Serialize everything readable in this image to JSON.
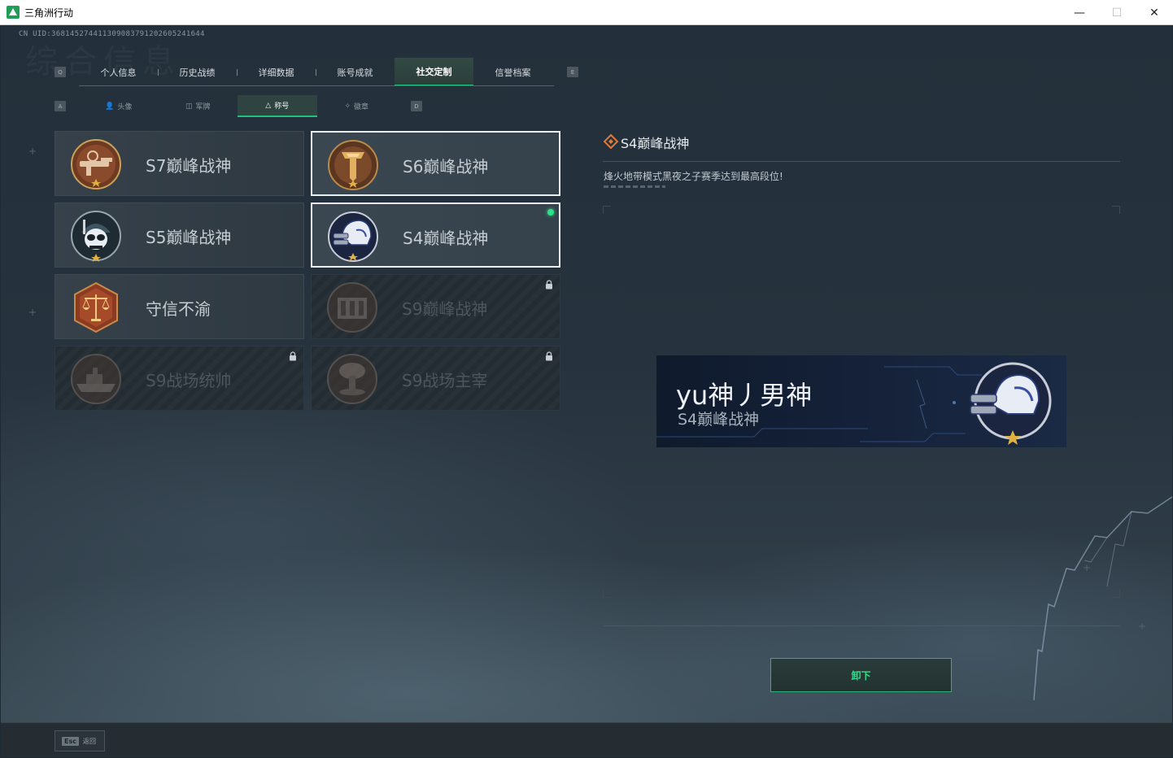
{
  "window": {
    "title": "三角洲行动",
    "controls": [
      "—",
      "☐",
      "✕"
    ]
  },
  "uid": "CN UID:368145274411309083791202605241644",
  "ghost_title": "综合信息",
  "tabs": {
    "prev_key": "Q",
    "next_key": "E",
    "items": [
      {
        "label": "个人信息",
        "active": false
      },
      {
        "label": "历史战绩",
        "active": false
      },
      {
        "label": "详细数据",
        "active": false
      },
      {
        "label": "账号成就",
        "active": false
      },
      {
        "label": "社交定制",
        "active": true
      },
      {
        "label": "信誉档案",
        "active": false
      }
    ]
  },
  "subtabs": {
    "prev_key": "A",
    "next_key": "D",
    "items": [
      {
        "label": "头像",
        "glyph": "👤",
        "active": false
      },
      {
        "label": "军牌",
        "glyph": "◫",
        "active": false
      },
      {
        "label": "称号",
        "glyph": "△",
        "active": true
      },
      {
        "label": "徽章",
        "glyph": "✧",
        "active": false
      }
    ]
  },
  "titles": [
    {
      "label": "S7巅峰战神",
      "icon": "gun-emblem-icon",
      "state": "unlocked",
      "selected": false,
      "equipped": false
    },
    {
      "label": "S6巅峰战神",
      "icon": "shield-t-emblem-icon",
      "state": "unlocked",
      "selected": true,
      "equipped": false
    },
    {
      "label": "S5巅峰战神",
      "icon": "skull-emblem-icon",
      "state": "unlocked",
      "selected": false,
      "equipped": false
    },
    {
      "label": "S4巅峰战神",
      "icon": "nightvision-helmet-emblem-icon",
      "state": "unlocked",
      "selected": true,
      "equipped": true
    },
    {
      "label": "守信不渝",
      "icon": "scales-emblem-icon",
      "state": "unlocked",
      "selected": false,
      "equipped": false
    },
    {
      "label": "S9巅峰战神",
      "icon": "dam-emblem-icon",
      "state": "locked",
      "selected": false,
      "equipped": false
    },
    {
      "label": "S9战场统帅",
      "icon": "warship-emblem-icon",
      "state": "locked",
      "selected": false,
      "equipped": false
    },
    {
      "label": "S9战场主宰",
      "icon": "mushroom-cloud-emblem-icon",
      "state": "locked",
      "selected": false,
      "equipped": false
    }
  ],
  "detail": {
    "title": "S4巅峰战神",
    "description": "烽火地带模式黑夜之子赛季达到最高段位!"
  },
  "nameplate": {
    "player_name": "yu神丿男神",
    "title": "S4巅峰战神"
  },
  "unequip_label": "卸下",
  "footer": {
    "esc_key": "Esc",
    "esc_label": "返回"
  },
  "colors": {
    "accent_green": "#1fc27c",
    "equipped_dot": "#29e28a",
    "emblem_bronze": "#a65a35",
    "emblem_gold": "#d4a23a",
    "nameplate_bg": "#15223a"
  }
}
